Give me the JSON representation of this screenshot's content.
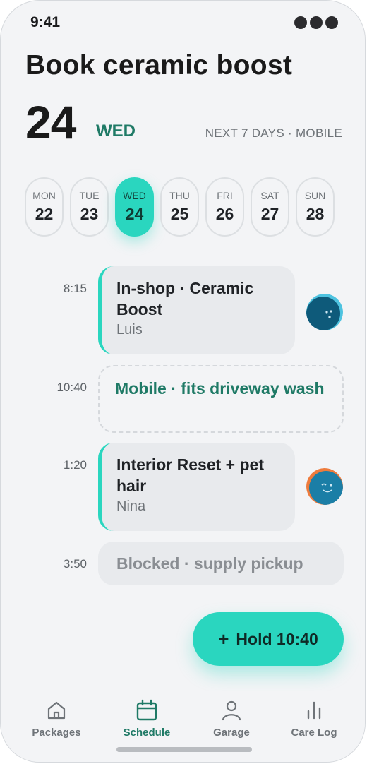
{
  "status": {
    "time": "9:41"
  },
  "header": {
    "title": "Book ceramic boost",
    "day_number": "24",
    "weekday": "WED",
    "range_label": "NEXT 7 DAYS · MOBILE"
  },
  "days": [
    {
      "name": "MON",
      "date": "22"
    },
    {
      "name": "TUE",
      "date": "23"
    },
    {
      "name": "WED",
      "date": "24",
      "selected": true
    },
    {
      "name": "THU",
      "date": "25"
    },
    {
      "name": "FRI",
      "date": "26"
    },
    {
      "name": "SAT",
      "date": "27"
    },
    {
      "name": "SUN",
      "date": "28"
    }
  ],
  "slots": [
    {
      "time": "8:15",
      "type": "booked",
      "title": "In-shop · Ceramic Boost",
      "staff": "Luis",
      "avatar": "avatar-luis"
    },
    {
      "time": "10:40",
      "type": "open",
      "title": "Mobile · fits driveway wash"
    },
    {
      "time": "1:20",
      "type": "booked",
      "title": "Interior Reset + pet hair",
      "staff": "Nina",
      "avatar": "avatar-nina"
    },
    {
      "time": "3:50",
      "type": "blocked",
      "title": "Blocked · supply pickup"
    }
  ],
  "fab": {
    "plus": "+",
    "label": "Hold 10:40"
  },
  "nav": [
    {
      "label": "Packages",
      "icon": "home-icon"
    },
    {
      "label": "Schedule",
      "icon": "calendar-icon",
      "active": true
    },
    {
      "label": "Garage",
      "icon": "person-icon"
    },
    {
      "label": "Care Log",
      "icon": "bar-chart-icon"
    }
  ],
  "colors": {
    "accent": "#2ad6bf",
    "accent_dark": "#1f7a66",
    "background": "#f3f4f6",
    "card": "#e8eaed"
  }
}
